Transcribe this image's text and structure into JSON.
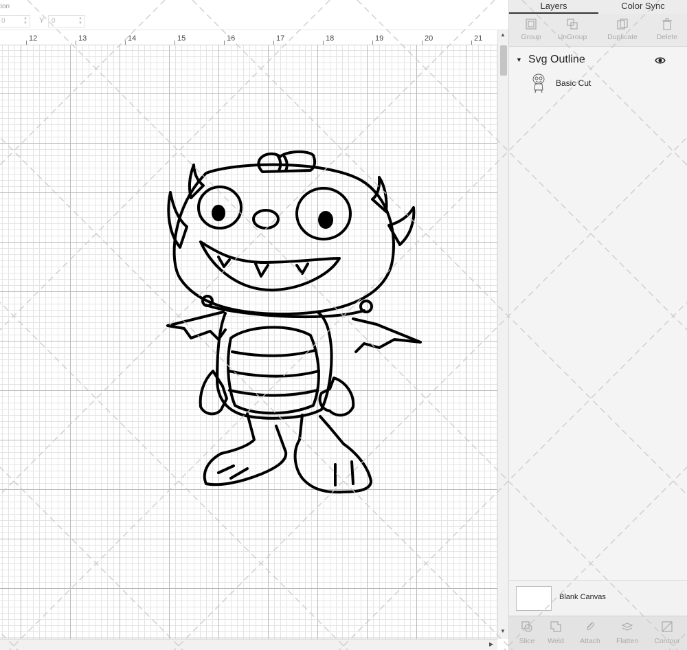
{
  "toolbar": {
    "position_label": "tion",
    "x_value": "0",
    "y_label": "Y",
    "y_value": "0"
  },
  "ruler": {
    "ticks": [
      "12",
      "13",
      "14",
      "15",
      "16",
      "17",
      "18",
      "19",
      "20",
      "21"
    ]
  },
  "panel": {
    "tabs": {
      "layers": "Layers",
      "color_sync": "Color Sync"
    },
    "layer_tools": {
      "group": "Group",
      "ungroup": "UnGroup",
      "duplicate": "Duplicate",
      "delete": "Delete"
    },
    "group_name": "Svg Outline",
    "layer_name": "Basic Cut",
    "blank_canvas": "Blank Canvas",
    "bottom_tools": {
      "slice": "Slice",
      "weld": "Weld",
      "attach": "Attach",
      "flatten": "Flatten",
      "contour": "Contour"
    }
  },
  "colors": {
    "panel_bg": "#f2f2f2",
    "disabled_text": "#aaaaaa",
    "grid_major": "#b9b9b9",
    "grid_minor": "#e4e4e4",
    "artwork_stroke": "#000000"
  },
  "icons": {
    "eye": "eye-icon",
    "caret": "caret-down-icon",
    "group": "group-icon",
    "ungroup": "ungroup-icon",
    "duplicate": "duplicate-icon",
    "delete": "trash-icon",
    "slice": "slice-icon",
    "weld": "weld-icon",
    "attach": "attach-icon",
    "flatten": "flatten-icon",
    "contour": "contour-icon"
  }
}
